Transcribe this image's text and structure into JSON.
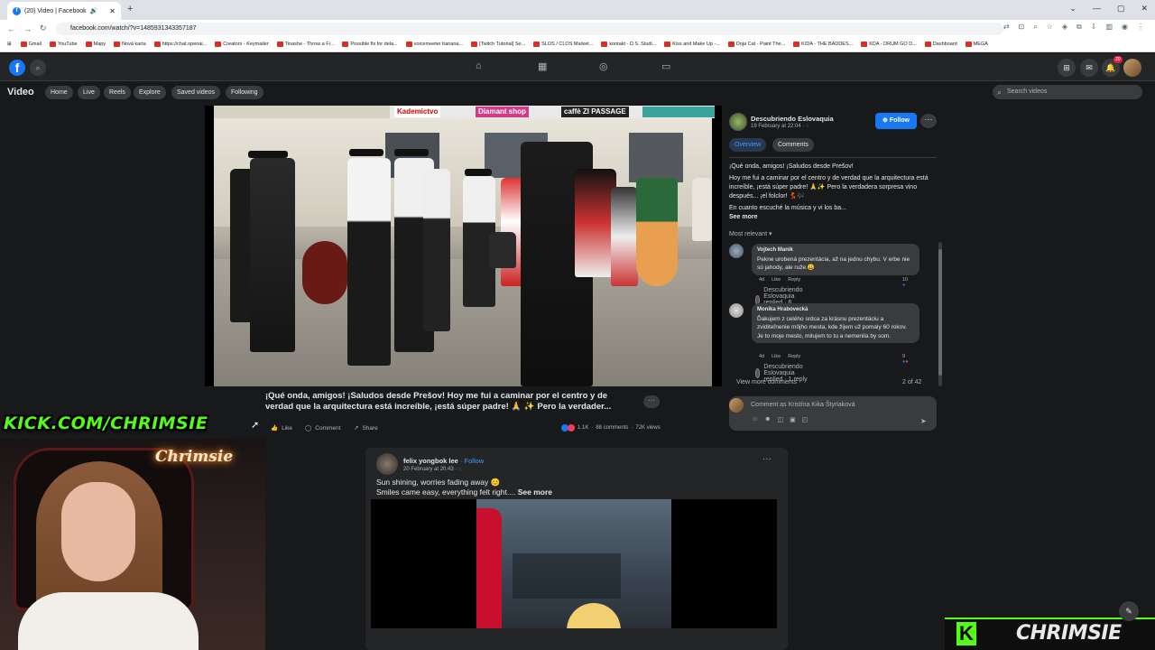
{
  "browser": {
    "tab_title": "(20) Video | Facebook",
    "url": "facebook.com/watch/?v=1485931343357187",
    "bookmarks": [
      "Gmail",
      "YouTube",
      "Mapy",
      "Nová karta",
      "https://chat.openai...",
      "Creators - Keymailer",
      "Tinashe - Throw a Fi...",
      "Possible fix for dela...",
      "voicemeeter banana...",
      "[Twitch Tutorial] Se...",
      "SLOS / CLOS Market...",
      "kontakt - D.S. Studi...",
      "Kiss and Make Up -...",
      "Doja Cat - Paint The...",
      "K/DA - THE BADDES...",
      "KDA - DRUM GO D...",
      "Dashboard",
      "MEGA"
    ]
  },
  "fb": {
    "notification_count": "20"
  },
  "video_header": {
    "title": "Video",
    "tabs": [
      "Home",
      "Live",
      "Reels",
      "Explore",
      "Saved videos",
      "Following"
    ],
    "search_placeholder": "Search videos"
  },
  "main_video": {
    "caption": "¡Qué onda, amigos! ¡Saludos desde Prešov! Hoy me fui a caminar por el centro y de verdad que la arquitectura está increíble, ¡está súper padre! 🙏 ✨ Pero la verdader...",
    "actions": [
      "Like",
      "Comment",
      "Share"
    ],
    "reactions": "1.1K",
    "comments_count": "88 comments",
    "views": "72K views",
    "signs": [
      "Kademictvo",
      "Diamant shop",
      "caffè ZI PASSAGE"
    ]
  },
  "panel": {
    "page_name": "Descubriendo Eslovaquia",
    "date": "19 February at 22:04 · ",
    "follow": "Follow",
    "tabs": [
      "Overview",
      "Comments"
    ],
    "desc_1": "¡Qué onda, amigos! ¡Saludos desde Prešov!",
    "desc_2": "Hoy me fui a caminar por el centro y de verdad que la arquitectura está increíble, ¡está súper padre! 🙏✨ Pero la verdadera sorpresa vino después... ¡el folclor! 💃🎶",
    "desc_3": "En cuanto escuché la música y vi los ba...",
    "see_more": "See more",
    "sort": "Most relevant",
    "comments": [
      {
        "author": "Vojtech Manik",
        "text": "Pekne urobená prezentácia, až na jednu chybu. V erbe nie sú jahody, ale ruže.😀",
        "time": "4d",
        "like": "Like",
        "reply": "Reply",
        "count": "10",
        "replied": "Descubriendo Eslovaquia replied · 6 replies"
      },
      {
        "author": "Monika Hrabovecká",
        "text": "Ďakujem z celého srdca za krásnu prezentáciu a zviditeľnenie môjho mesta, kde žijem už pomaly 60 rokov. Je to moje mesto, milujem to tu a nemenila by som.",
        "time": "4d",
        "like": "Like",
        "reply": "Reply",
        "count": "9",
        "replied": "Descubriendo Eslovaquia replied · 1 reply"
      }
    ],
    "view_more": "View more comments",
    "pager": "2 of 42",
    "comment_placeholder": "Comment as Kristína Kika Štyriaková"
  },
  "post2": {
    "author": "felix yongbok lee",
    "follow": " · Follow",
    "date": "20 February at 20:43 · ",
    "line1": "Sun shining, worries fading away 😊",
    "line2": "Smiles came easy, everything felt right....",
    "see_more": "See more"
  },
  "overlay": {
    "kick_url": "KICK.COM/CHRIMSIE",
    "neon": "Chrimsie",
    "brand_k": "K",
    "brand_name": "CHRIMSIE",
    "kick_color": "#53fc18"
  }
}
